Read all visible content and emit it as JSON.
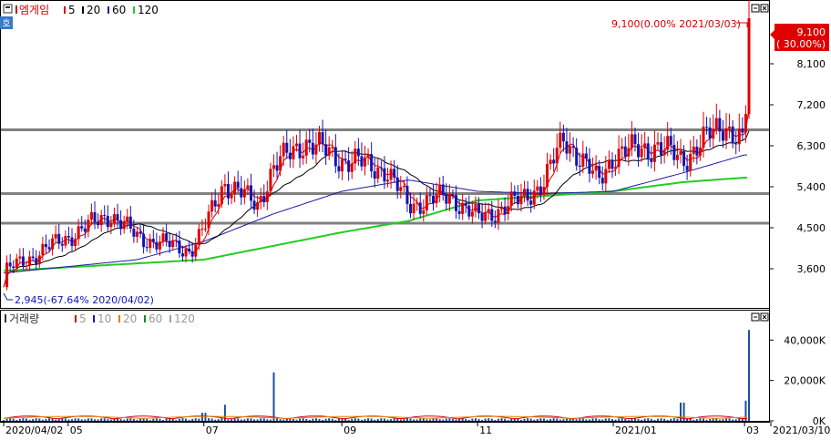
{
  "stock": {
    "name": "엠게임",
    "code_icon": "square-icon",
    "settings_icon": "gear-icon"
  },
  "price_legend": [
    {
      "label": "5",
      "color": "#d40000"
    },
    {
      "label": "20",
      "color": "#000000"
    },
    {
      "label": "60",
      "color": "#1a1aa8"
    },
    {
      "label": "120",
      "color": "#22cc22"
    }
  ],
  "volume_title": "거래량",
  "volume_legend": [
    {
      "label": "5",
      "color": "#d40000"
    },
    {
      "label": "10",
      "color": "#1a1aa8"
    },
    {
      "label": "20",
      "color": "#e08000"
    },
    {
      "label": "60",
      "color": "#1a8a1a"
    },
    {
      "label": "120",
      "color": "#a0a0a0"
    }
  ],
  "colors": {
    "up": "#e00000",
    "down": "#1414b4",
    "ma5": "#d40000",
    "ma20": "#000000",
    "ma60": "#1a1aa8",
    "ma120": "#22cc22",
    "support": "#808080",
    "badge_bg": "#e00000",
    "badge_text": "#ffffff",
    "volume_bar": "#1a4fa0"
  },
  "annotations": {
    "high": "9,100(0.00% 2021/03/03)",
    "low": "2,945(-67.64% 2020/04/02)",
    "current_price": "9,100",
    "current_change": "( 30.00%)"
  },
  "chart_data": [
    {
      "type": "candlestick",
      "title": "엠게임",
      "y_ticks": [
        "3,600",
        "4,500",
        "5,400",
        "6,300",
        "7,200",
        "8,100"
      ],
      "ylim": [
        2900,
        9300
      ],
      "support_levels": [
        4600,
        5250,
        6650
      ],
      "x_labels": [
        "2020/04/02",
        "05",
        "07",
        "09",
        "11",
        "2021/01",
        "03",
        "2021/03/10"
      ],
      "grid": false,
      "high": {
        "value": 9100,
        "date": "2021/03/03"
      },
      "low": {
        "value": 2945,
        "date": "2020/04/02"
      },
      "last_close": 9100,
      "last_change_pct": 30.0,
      "series_close": [
        {
          "date": "2020/04",
          "value": 3500
        },
        {
          "date": "2020/05",
          "value": 4300
        },
        {
          "date": "2020/05/20",
          "value": 4800
        },
        {
          "date": "2020/06",
          "value": 4300
        },
        {
          "date": "2020/06/25",
          "value": 4000
        },
        {
          "date": "2020/07",
          "value": 4450
        },
        {
          "date": "2020/07/10",
          "value": 5500
        },
        {
          "date": "2020/07/25",
          "value": 5000
        },
        {
          "date": "2020/08",
          "value": 5800
        },
        {
          "date": "2020/08/15",
          "value": 6400
        },
        {
          "date": "2020/09",
          "value": 6000
        },
        {
          "date": "2020/09/20",
          "value": 5800
        },
        {
          "date": "2020/10",
          "value": 5000
        },
        {
          "date": "2020/10/20",
          "value": 5200
        },
        {
          "date": "2020/11",
          "value": 4700
        },
        {
          "date": "2020/11/20",
          "value": 5100
        },
        {
          "date": "2020/12",
          "value": 5500
        },
        {
          "date": "2020/12/10",
          "value": 6500
        },
        {
          "date": "2020/12/25",
          "value": 5500
        },
        {
          "date": "2021/01",
          "value": 6100
        },
        {
          "date": "2021/01/20",
          "value": 6300
        },
        {
          "date": "2021/02",
          "value": 6000
        },
        {
          "date": "2021/02/20",
          "value": 6800
        },
        {
          "date": "2021/03",
          "value": 6300
        },
        {
          "date": "2021/03/03",
          "value": 9100
        }
      ],
      "ma120": [
        {
          "date": "2020/04",
          "value": 3550
        },
        {
          "date": "2020/07",
          "value": 3800
        },
        {
          "date": "2020/09",
          "value": 4400
        },
        {
          "date": "2020/10",
          "value": 4650
        },
        {
          "date": "2020/11",
          "value": 5100
        },
        {
          "date": "2021/01",
          "value": 5300
        },
        {
          "date": "2021/02",
          "value": 5500
        },
        {
          "date": "2021/03",
          "value": 5600
        }
      ],
      "ma60": [
        {
          "date": "2020/04",
          "value": 3500
        },
        {
          "date": "2020/06",
          "value": 3800
        },
        {
          "date": "2020/07",
          "value": 4200
        },
        {
          "date": "2020/08",
          "value": 4800
        },
        {
          "date": "2020/09",
          "value": 5300
        },
        {
          "date": "2020/10",
          "value": 5550
        },
        {
          "date": "2020/11",
          "value": 5300
        },
        {
          "date": "2020/12",
          "value": 5250
        },
        {
          "date": "2021/01",
          "value": 5300
        },
        {
          "date": "2021/02",
          "value": 5700
        },
        {
          "date": "2021/03",
          "value": 6100
        }
      ]
    },
    {
      "type": "bar",
      "title": "거래량",
      "y_ticks": [
        "0K",
        "20,000K",
        "40,000K"
      ],
      "ylim": [
        0,
        46000
      ],
      "peaks": [
        {
          "date": "2020/07",
          "value": 4000
        },
        {
          "date": "2020/07/10",
          "value": 8000
        },
        {
          "date": "2020/08",
          "value": 24000
        },
        {
          "date": "2020/10",
          "value": 1500
        },
        {
          "date": "2021/02",
          "value": 9000
        },
        {
          "date": "2021/03/02",
          "value": 10000
        },
        {
          "date": "2021/03/03",
          "value": 45000
        }
      ]
    }
  ]
}
